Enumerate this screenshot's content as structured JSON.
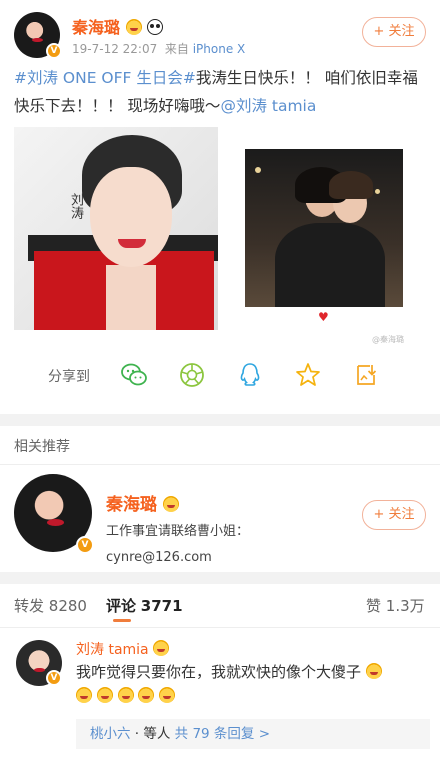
{
  "post": {
    "author": "秦海璐",
    "date": "19-7-12 22:07",
    "source_prefix": "来自",
    "source": "iPhone X",
    "follow_label": "+ 关注",
    "topic": "#刘涛 ONE OFF 生日会#",
    "text": "我涛生日快乐！！ 咱们依旧幸福快乐下去！！！ 现场好嗨哦～",
    "mention": "@刘涛 tamia",
    "image1_caption": "刘涛",
    "watermark": "@秦海璐"
  },
  "share": {
    "label": "分享到",
    "targets": [
      "wechat-icon",
      "moments-icon",
      "qq-icon",
      "qzone-icon",
      "save-icon"
    ]
  },
  "related": {
    "title": "相关推荐",
    "name": "秦海璐",
    "line1": "工作事宜请联络曹小姐：",
    "line2": "cynre@126.com",
    "follow_label": "+ 关注"
  },
  "tabs": {
    "repost_label": "转发",
    "repost_count": "8280",
    "comment_label": "评论",
    "comment_count": "3771",
    "like_label": "赞",
    "like_count": "1.3万"
  },
  "comment": {
    "name": "刘涛 tamia",
    "line1": "我咋觉得只要你在，我就欢快的像个大傻子",
    "reply_user": "桃小六",
    "reply_mid": "等人",
    "reply_link": "共 79 条回复 >"
  },
  "colors": {
    "accent_orange": "#f07d3c",
    "name_orange": "#f5611e",
    "link_blue": "#5b8fce"
  }
}
